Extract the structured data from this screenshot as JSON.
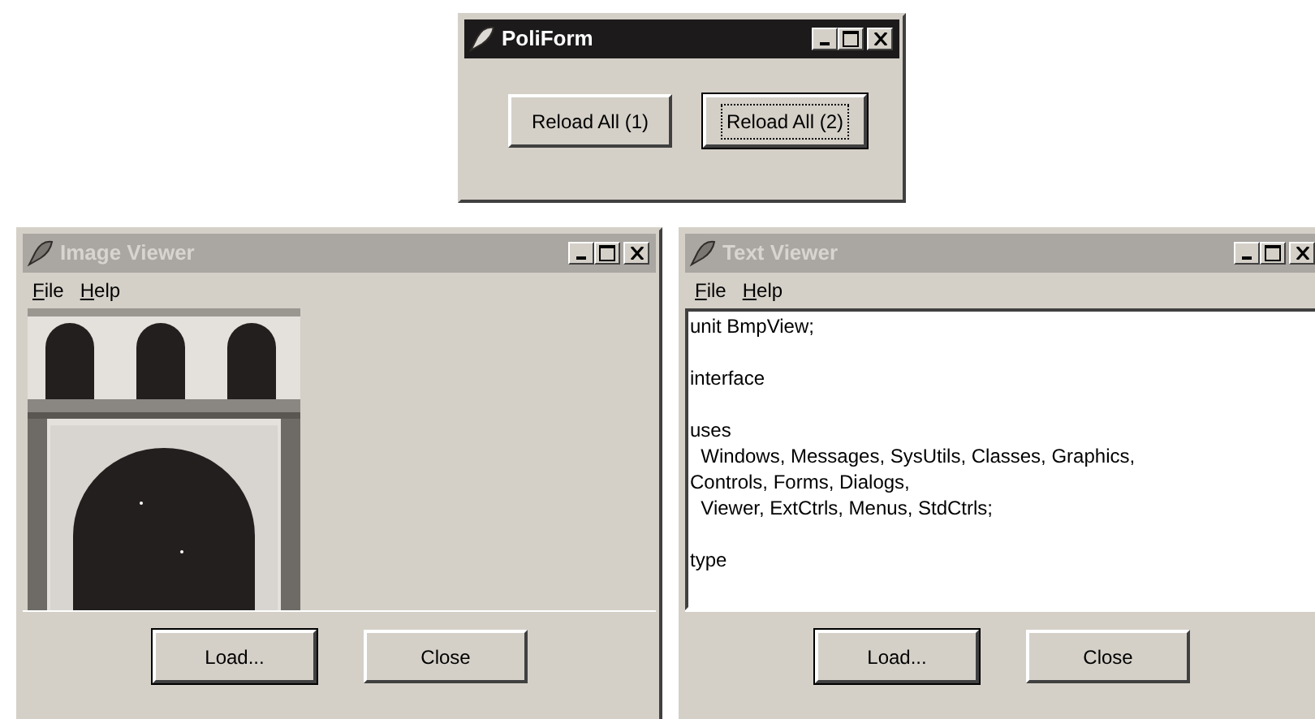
{
  "windows": [
    {
      "kind": "buttons",
      "title": "PoliForm",
      "active": true,
      "buttons": [
        {
          "label": "Reload All (1)",
          "default": false
        },
        {
          "label": "Reload All (2)",
          "default": true
        }
      ]
    },
    {
      "title": "Image Viewer",
      "active": false,
      "menu": [
        "File",
        "Help"
      ],
      "content": {
        "kind": "picture"
      },
      "buttons": [
        {
          "label": "Load...",
          "default": true
        },
        {
          "label": "Close",
          "default": false
        }
      ]
    },
    {
      "kind": "text",
      "title": "Text Viewer",
      "active": false,
      "menu": [
        "File",
        "Help"
      ],
      "paragraphs": [
        {
          "lines": [
            "unit BmpView;"
          ]
        },
        {
          "lines": [
            "interface"
          ]
        },
        {
          "lines": [
            "uses",
            "  Windows, Messages, SysUtils, Classes, Graphics,",
            "Controls, Forms, Dialogs,",
            "  Viewer, ExtCtrls, Menus, StdCtrls;"
          ]
        },
        {
          "lines": [
            "type"
          ]
        }
      ],
      "buttons": [
        {
          "label": "Load...",
          "default": true
        },
        {
          "label": "Close",
          "default": false
        }
      ]
    }
  ]
}
